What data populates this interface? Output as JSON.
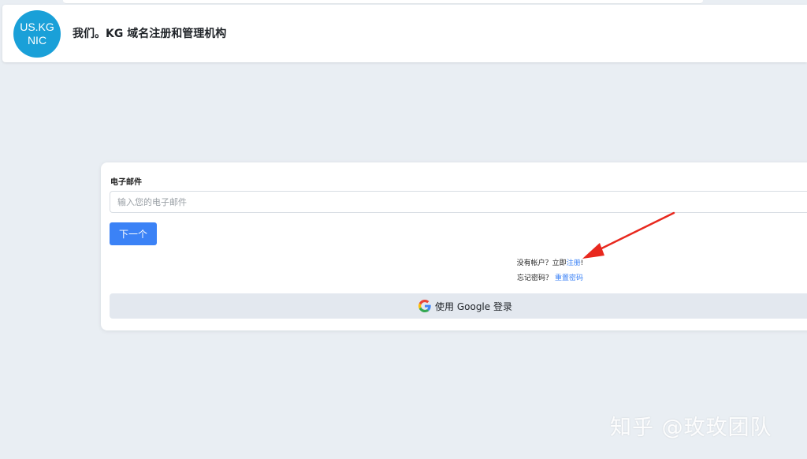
{
  "header": {
    "logo_line1": "US.KG",
    "logo_line2": "NIC",
    "title": "我们。KG 域名注册和管理机构"
  },
  "login_form": {
    "email_label": "电子邮件",
    "email_placeholder": "输入您的电子邮件",
    "email_value": "",
    "next_label": "下一个",
    "signup_prompt": "没有帐户？立即",
    "signup_link": "注册",
    "signup_suffix": "!",
    "forgot_prompt": "忘记密码？",
    "reset_link": "重置密码",
    "google_label": "使用 Google 登录"
  },
  "watermark": {
    "text": "知乎 @玫玫团队"
  },
  "colors": {
    "page_background": "#e9eef3",
    "logo_circle": "#1aa0d8",
    "primary_button": "#3b82f6",
    "link": "#3b82f6",
    "google_button_bg": "#e3e8ef",
    "annotation_arrow": "#e8281e"
  },
  "icons": {
    "google_button": "google-g-icon"
  }
}
